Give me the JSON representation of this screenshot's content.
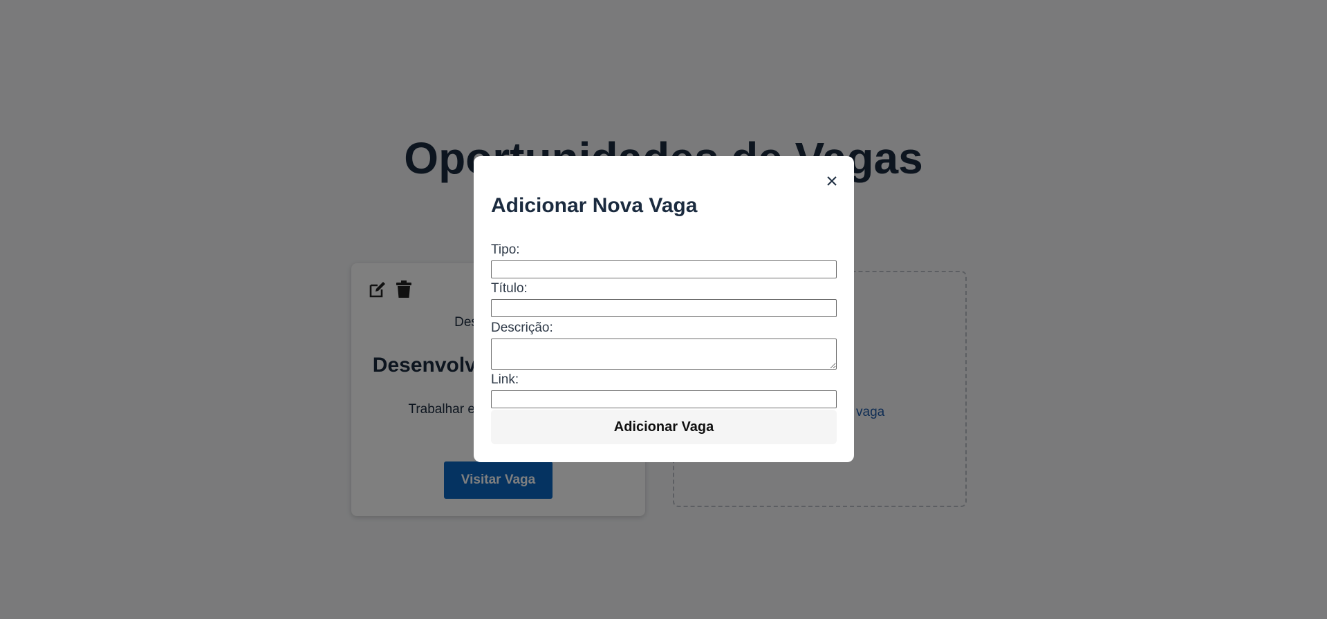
{
  "page": {
    "title": "Oportunidades de Vagas"
  },
  "job_card": {
    "type": "Desenvolvedor",
    "title": "Desenvolvedor Front-end",
    "description": "Trabalhar em projetos incríveis",
    "visit_label": "Visitar Vaga",
    "edit_icon": "edit-icon",
    "delete_icon": "trash-icon"
  },
  "add_card": {
    "link_label": "+ Adicionar nova vaga"
  },
  "modal": {
    "title": "Adicionar Nova Vaga",
    "close_icon": "close-icon",
    "fields": {
      "tipo_label": "Tipo:",
      "tipo_value": "",
      "titulo_label": "Título:",
      "titulo_value": "",
      "descricao_label": "Descrição:",
      "descricao_value": "",
      "link_label": "Link:",
      "link_value": ""
    },
    "submit_label": "Adicionar Vaga"
  },
  "colors": {
    "heading": "#1b2b3f",
    "primary_button": "#0a66c2",
    "link": "#1f5ba9",
    "overlay": "rgba(0,0,0,0.5)"
  }
}
